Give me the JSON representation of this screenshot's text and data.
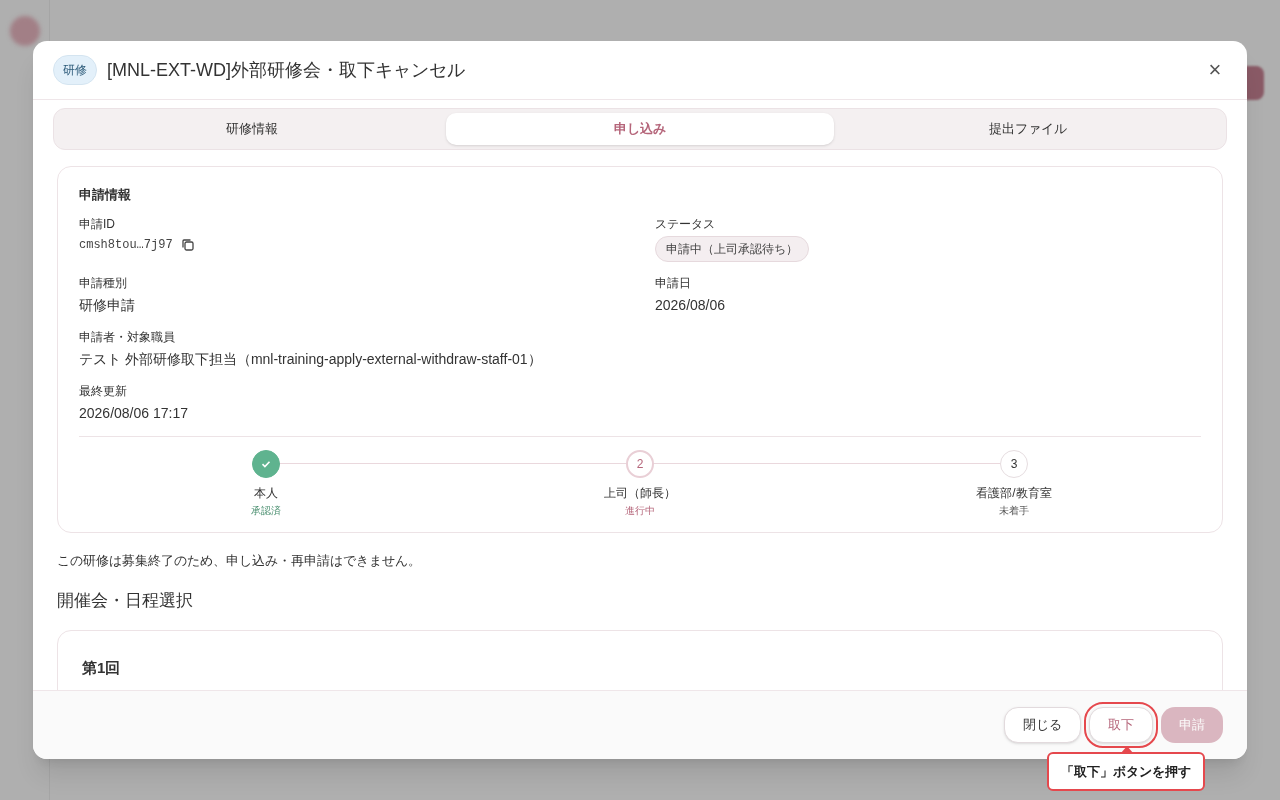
{
  "dialog": {
    "badge": "研修",
    "title": "[MNL-EXT-WD]外部研修会・取下キャンセル",
    "close_icon": "×"
  },
  "tabs": [
    {
      "label": "研修情報",
      "selected": false
    },
    {
      "label": "申し込み",
      "selected": true
    },
    {
      "label": "提出ファイル",
      "selected": false
    }
  ],
  "application_info": {
    "heading": "申請情報",
    "fields": [
      {
        "label": "申請ID",
        "value": "cmsh8tou…7j97",
        "kind": "id"
      },
      {
        "label": "ステータス",
        "value": "申請中（上司承認待ち）",
        "kind": "status"
      },
      {
        "label": "申請種別",
        "value": "研修申請",
        "kind": "text"
      },
      {
        "label": "申請日",
        "value": "2026/08/06",
        "kind": "text"
      },
      {
        "label": "申請者・対象職員",
        "value": "テスト 外部研修取下担当（mnl-training-apply-external-withdraw-staff-01）",
        "kind": "wide"
      },
      {
        "label": "最終更新",
        "value": "2026/08/06 17:17",
        "kind": "wide"
      }
    ],
    "steps": [
      {
        "name": "本人",
        "state_label": "承認済",
        "kind": "done"
      },
      {
        "marker": "2",
        "name": "上司（師長）",
        "state_label": "進行中",
        "kind": "current"
      },
      {
        "marker": "3",
        "name": "看護部/教育室",
        "state_label": "未着手",
        "kind": "pending"
      }
    ]
  },
  "notice": "この研修は募集終了のため、申し込み・再申請はできません。",
  "section_heading": "開催会・日程選択",
  "session_card": {
    "title": "第1回"
  },
  "footer_buttons": [
    {
      "label": "閉じる",
      "kind": "close",
      "disabled": false,
      "highlighted": false
    },
    {
      "label": "取下",
      "kind": "withdraw",
      "disabled": false,
      "highlighted": true
    },
    {
      "label": "申請",
      "kind": "apply",
      "disabled": true,
      "highlighted": false
    }
  ],
  "callout": {
    "text": "「取下」ボタンを押す"
  }
}
